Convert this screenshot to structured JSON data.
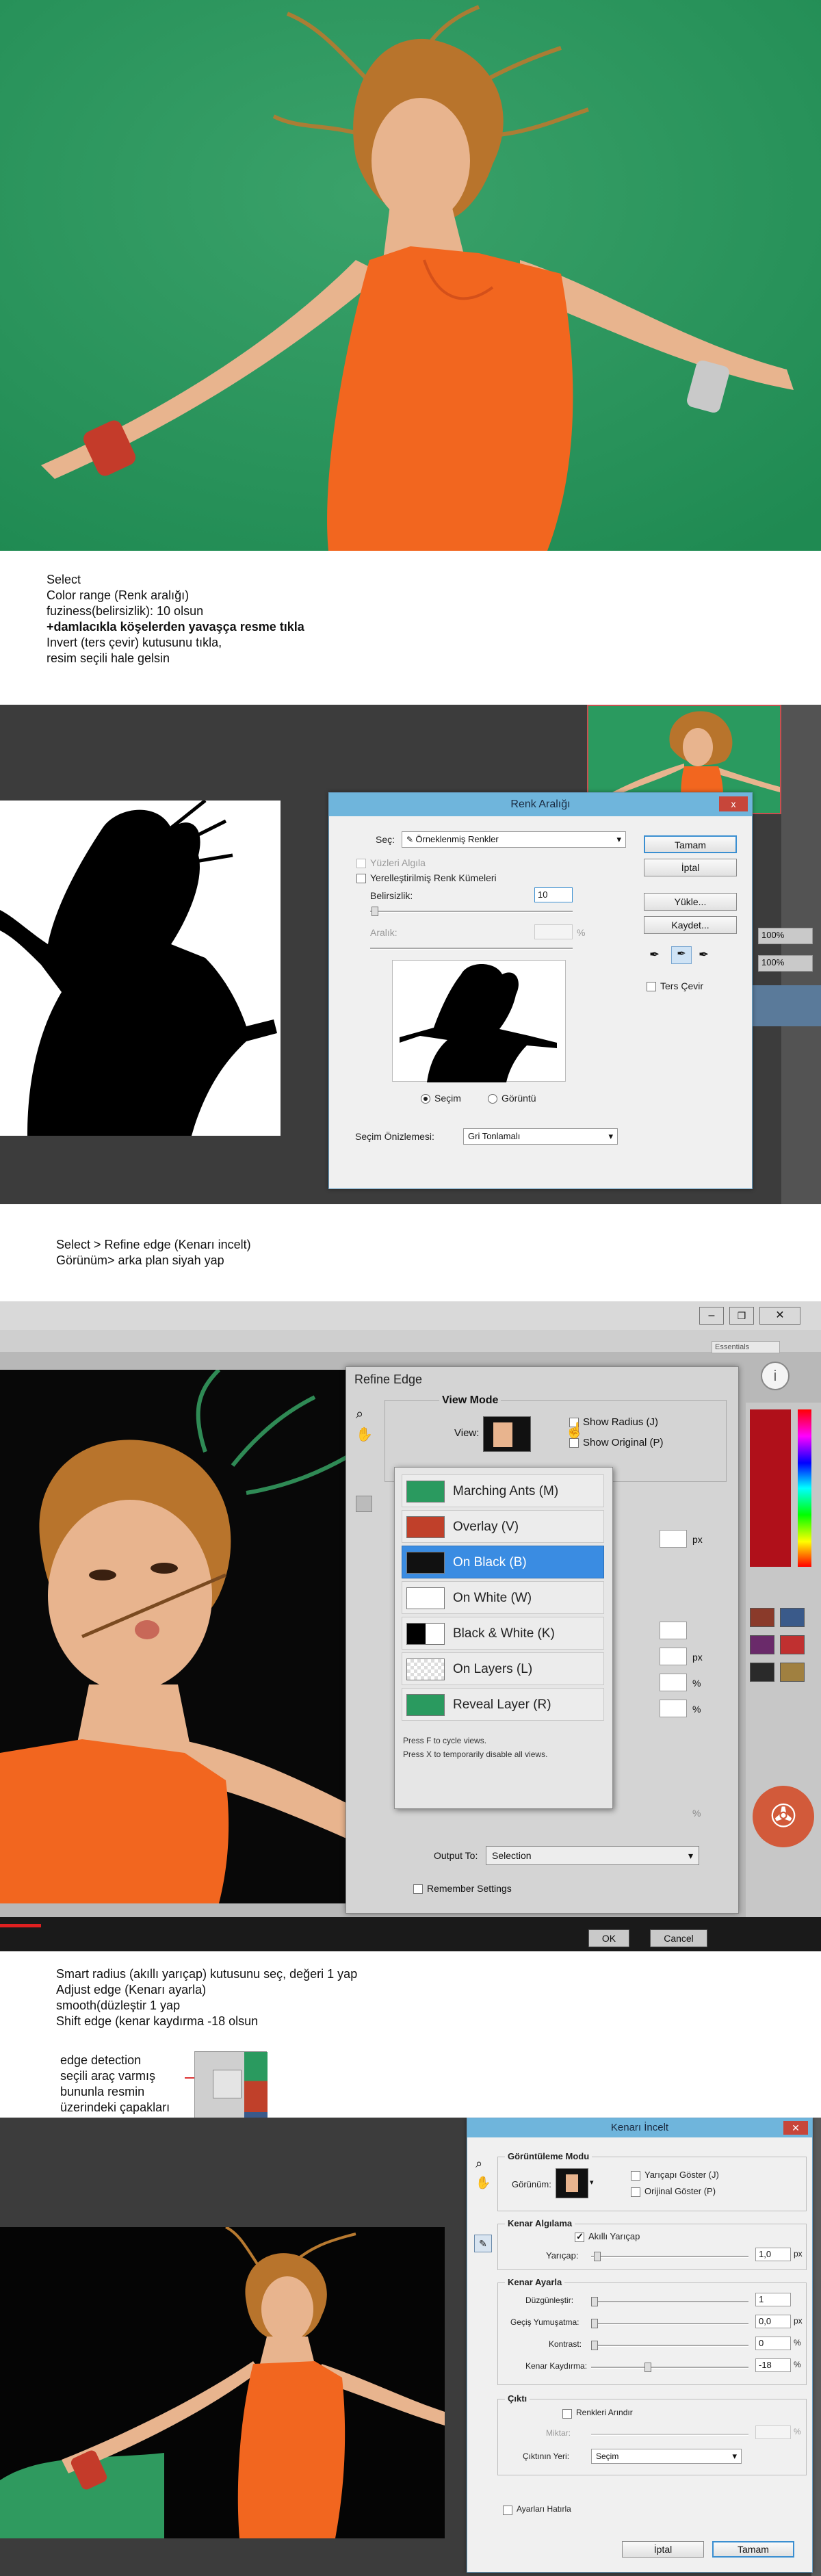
{
  "notes": {
    "step1": [
      "Select",
      "Color range (Renk aralığı)",
      "fuziness(belirsizlik): 10 olsun",
      "+damlacıkla köşelerden yavaşça resme tıkla",
      "Invert (ters çevir) kutusunu tıkla,",
      "resim seçili hale gelsin"
    ],
    "step2": [
      "Select > Refine edge (Kenarı incelt)",
      "Görünüm> arka plan siyah yap"
    ],
    "step3": [
      "Smart radius (akıllı yarıçap) kutusunu seç, değeri 1 yap",
      "Adjust edge (Kenarı ayarla)",
      "smooth(düzleştir 1 yap",
      "Shift edge (kenar kaydırma -18 olsun"
    ],
    "step4": [
      "edge detection",
      "seçili araç varmış",
      "bununla resmin",
      "üzerindeki çapakları"
    ]
  },
  "color_range": {
    "title": "Renk Aralığı",
    "close": "x",
    "select_label": "Seç:",
    "select_value": "Örneklenmiş Renkler",
    "detect_faces": "Yüzleri Algıla",
    "localized": "Yerelleştirilmiş Renk Kümeleri",
    "fuzziness_label": "Belirsizlik:",
    "fuzziness_value": "10",
    "range_label": "Aralık:",
    "range_unit": "%",
    "radio_selection": "Seçim",
    "radio_image": "Görüntü",
    "preview_label": "Seçim Önizlemesi:",
    "preview_value": "Gri Tonlamalı",
    "buttons": {
      "ok": "Tamam",
      "cancel": "İptal",
      "load": "Yükle...",
      "save": "Kaydet..."
    },
    "invert": "Ters Çevir",
    "side_fields": [
      "100%",
      "100%"
    ]
  },
  "refine_edge": {
    "title": "Refine Edge",
    "view_mode": "View Mode",
    "view_label": "View:",
    "show_radius": "Show Radius (J)",
    "show_original": "Show Original (P)",
    "menu": [
      {
        "label": "Marching Ants (M)",
        "selected": false
      },
      {
        "label": "Overlay (V)",
        "selected": false
      },
      {
        "label": "On Black (B)",
        "selected": true
      },
      {
        "label": "On White (W)",
        "selected": false
      },
      {
        "label": "Black & White (K)",
        "selected": false
      },
      {
        "label": "On Layers (L)",
        "selected": false
      },
      {
        "label": "Reveal Layer (R)",
        "selected": false
      }
    ],
    "hint1": "Press F to cycle views.",
    "hint2": "Press X to temporarily disable all views.",
    "output_label": "Output To:",
    "output_value": "Selection",
    "remember": "Remember Settings",
    "ok": "OK",
    "cancel": "Cancel",
    "essentials": "Essentials",
    "px": "px",
    "pct": "%"
  },
  "kenar_incelt": {
    "title": "Kenarı İncelt",
    "view_mode": "Görüntüleme Modu",
    "view_label": "Görünüm:",
    "show_radius": "Yarıçapı Göster (J)",
    "show_original": "Orijinal Göster (P)",
    "edge_detection": "Kenar Algılama",
    "smart_radius": "Akıllı Yarıçap",
    "radius_label": "Yarıçap:",
    "radius_value": "1,0",
    "adjust_edge": "Kenar Ayarla",
    "smooth_label": "Düzgünleştir:",
    "smooth_value": "1",
    "feather_label": "Geçiş Yumuşatma:",
    "feather_value": "0,0",
    "contrast_label": "Kontrast:",
    "contrast_value": "0",
    "shift_label": "Kenar Kaydırma:",
    "shift_value": "-18",
    "output": "Çıktı",
    "decontaminate": "Renkleri Arındır",
    "amount_label": "Miktar:",
    "output_to_label": "Çıktının Yeri:",
    "output_to_value": "Seçim",
    "remember": "Ayarları Hatırla",
    "ok": "İptal",
    "cancel": "Tamam",
    "px": "px",
    "pct": "%"
  },
  "colors": {
    "green_bg": "#2a9a5f",
    "orange_shirt": "#f2661f",
    "ps_dark": "#3c3c3c",
    "dialog_title": "#6fb5dc",
    "selection_blue": "#3a8ce2"
  }
}
